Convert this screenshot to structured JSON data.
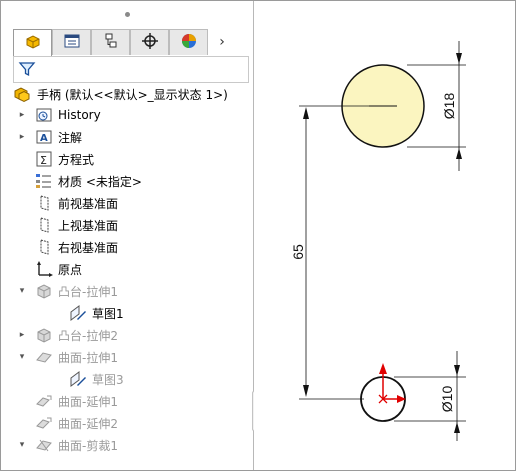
{
  "tree": {
    "root_label": "手柄  (默认<<默认>_显示状态 1>)",
    "items": [
      {
        "label": "History",
        "expander": "▸",
        "icon": "history-icon",
        "dim": false
      },
      {
        "label": "注解",
        "expander": "▸",
        "icon": "annotation-icon",
        "dim": false
      },
      {
        "label": "方程式",
        "expander": "",
        "icon": "equation-icon",
        "dim": false
      },
      {
        "label": "材质 <未指定>",
        "expander": "",
        "icon": "material-icon",
        "dim": false
      },
      {
        "label": "前视基准面",
        "expander": "",
        "icon": "plane-icon",
        "dim": false
      },
      {
        "label": "上视基准面",
        "expander": "",
        "icon": "plane-icon",
        "dim": false
      },
      {
        "label": "右视基准面",
        "expander": "",
        "icon": "plane-icon",
        "dim": false
      },
      {
        "label": "原点",
        "expander": "",
        "icon": "origin-icon",
        "dim": false
      },
      {
        "label": "凸台-拉伸1",
        "expander": "▾",
        "icon": "boss-extrude-icon",
        "dim": true
      },
      {
        "label": "草图1",
        "expander": "",
        "icon": "sketch-icon",
        "dim": false
      },
      {
        "label": "凸台-拉伸2",
        "expander": "▸",
        "icon": "boss-extrude-icon",
        "dim": true
      },
      {
        "label": "曲面-拉伸1",
        "expander": "▾",
        "icon": "surface-extrude-icon",
        "dim": true
      },
      {
        "label": "草图3",
        "expander": "",
        "icon": "sketch-icon",
        "dim": true
      },
      {
        "label": "曲面-延伸1",
        "expander": "",
        "icon": "surface-extend-icon",
        "dim": true
      },
      {
        "label": "曲面-延伸2",
        "expander": "",
        "icon": "surface-extend-icon",
        "dim": true
      },
      {
        "label": "曲面-剪裁1",
        "expander": "▾",
        "icon": "surface-trim-icon",
        "dim": true
      }
    ]
  },
  "tabs": [
    {
      "icon": "feature-manager-icon"
    },
    {
      "icon": "property-manager-icon"
    },
    {
      "icon": "configuration-manager-icon"
    },
    {
      "icon": "dimxpert-icon"
    },
    {
      "icon": "display-manager-icon"
    }
  ],
  "tab_more": "›",
  "sketch": {
    "dim_large_circle": "Ø18",
    "dim_small_circle": "Ø10",
    "dim_distance": "65",
    "large_circle_fill": "#fbf5c0",
    "origin_color": "#e00000"
  }
}
